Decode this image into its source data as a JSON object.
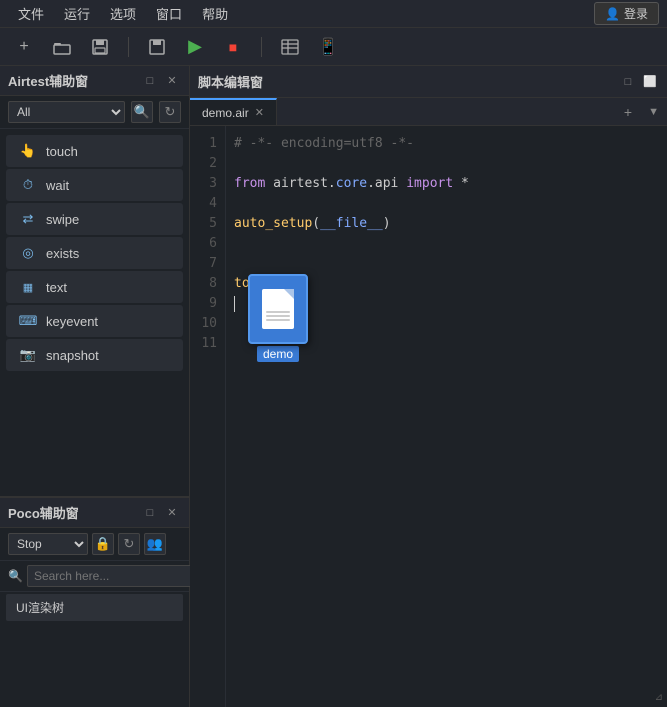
{
  "menubar": {
    "items": [
      "文件",
      "运行",
      "选项",
      "窗口",
      "帮助"
    ],
    "login": "登录"
  },
  "toolbar": {
    "buttons": [
      {
        "name": "add",
        "icon": "+"
      },
      {
        "name": "folder",
        "icon": "📁"
      },
      {
        "name": "save",
        "icon": "💾"
      },
      {
        "name": "save-file",
        "icon": "💾"
      },
      {
        "name": "run",
        "icon": "▶"
      },
      {
        "name": "stop",
        "icon": "■"
      },
      {
        "name": "table",
        "icon": "▤"
      },
      {
        "name": "device",
        "icon": "📱"
      }
    ]
  },
  "airtest_panel": {
    "title": "Airtest辅助窗",
    "dropdown_value": "All",
    "items": [
      {
        "name": "touch",
        "icon": "👆",
        "label": "touch"
      },
      {
        "name": "wait",
        "icon": "⏱",
        "label": "wait"
      },
      {
        "name": "swipe",
        "icon": "⇄",
        "label": "swipe"
      },
      {
        "name": "exists",
        "icon": "◎",
        "label": "exists"
      },
      {
        "name": "text",
        "icon": "▦",
        "label": "text"
      },
      {
        "name": "keyevent",
        "icon": "⌨",
        "label": "keyevent"
      },
      {
        "name": "snapshot",
        "icon": "📷",
        "label": "snapshot"
      }
    ]
  },
  "poco_panel": {
    "title": "Poco辅助窗",
    "stop_label": "Stop",
    "search_placeholder": "Search here...",
    "tree_item": "UI渲染树"
  },
  "editor": {
    "title": "脚本编辑窗",
    "tab_name": "demo.air",
    "lines": [
      {
        "num": 1,
        "content": "# -*- encoding=utf8 -*-",
        "type": "comment"
      },
      {
        "num": 2,
        "content": "",
        "type": "plain"
      },
      {
        "num": 3,
        "content": "from airtest.core.api import *",
        "type": "mixed"
      },
      {
        "num": 4,
        "content": "",
        "type": "plain"
      },
      {
        "num": 5,
        "content": "auto_setup(__file__)",
        "type": "func"
      },
      {
        "num": 6,
        "content": "",
        "type": "plain"
      },
      {
        "num": 7,
        "content": "",
        "type": "plain"
      },
      {
        "num": 8,
        "content": "touch(",
        "type": "mixed"
      },
      {
        "num": 9,
        "content": "",
        "type": "plain"
      },
      {
        "num": 10,
        "content": "",
        "type": "plain"
      },
      {
        "num": 11,
        "content": "",
        "type": "plain"
      }
    ],
    "file_label": "demo"
  }
}
